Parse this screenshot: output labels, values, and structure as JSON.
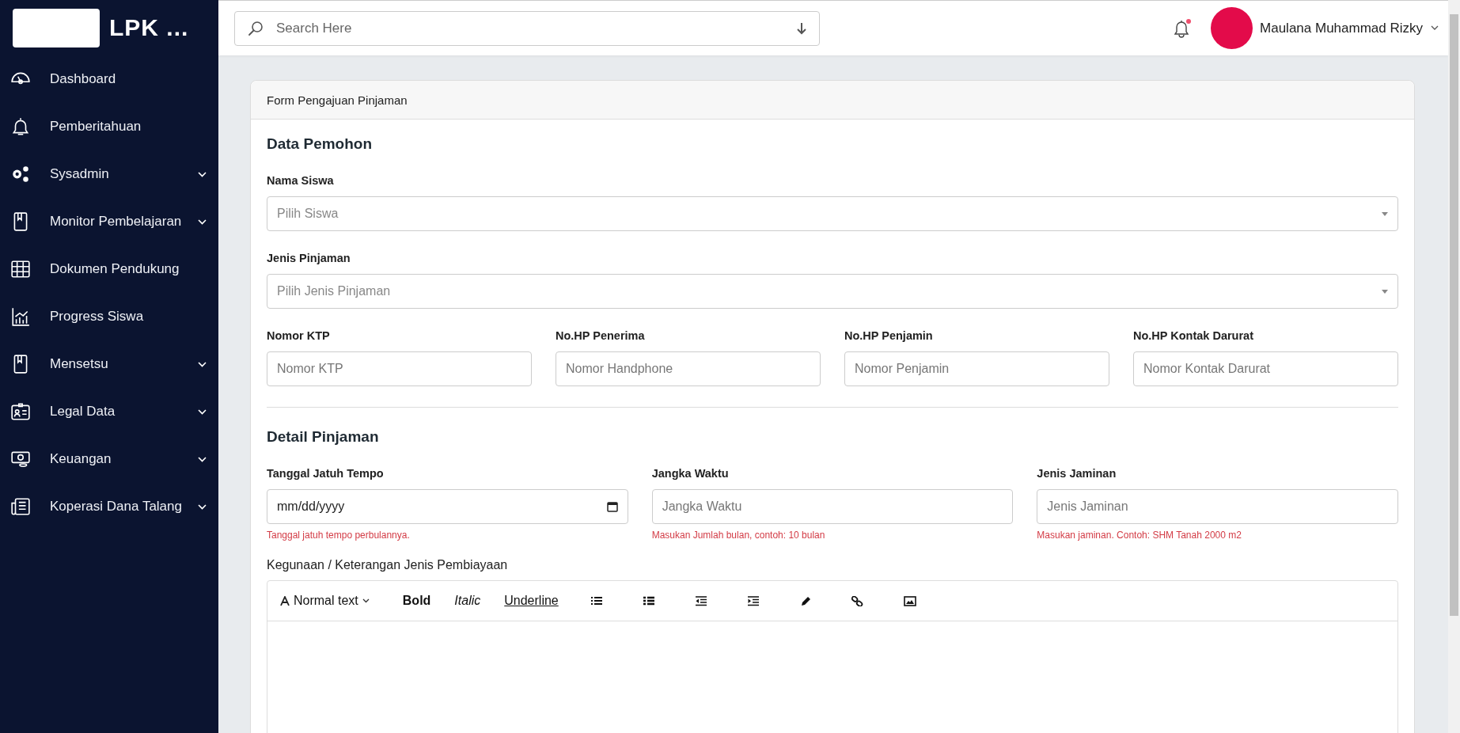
{
  "sidebar": {
    "brand": "LPK ...",
    "items": [
      {
        "label": "Dashboard",
        "expandable": false
      },
      {
        "label": "Pemberitahuan",
        "expandable": false
      },
      {
        "label": "Sysadmin",
        "expandable": true
      },
      {
        "label": "Monitor Pembelajaran",
        "expandable": true
      },
      {
        "label": "Dokumen Pendukung",
        "expandable": false
      },
      {
        "label": "Progress Siswa",
        "expandable": false
      },
      {
        "label": "Mensetsu",
        "expandable": true
      },
      {
        "label": "Legal Data",
        "expandable": true
      },
      {
        "label": "Keuangan",
        "expandable": true
      },
      {
        "label": "Koperasi Dana Talang",
        "expandable": true
      }
    ]
  },
  "topbar": {
    "search": {
      "placeholder": "Search Here"
    },
    "notification": {
      "unread": true
    },
    "user": {
      "name": "Maulana Muhammad Rizky"
    }
  },
  "card": {
    "title": "Form Pengajuan Pinjaman",
    "sections": [
      {
        "heading": "Data Pemohon",
        "rows": [
          [
            {
              "kind": "select",
              "label": "Nama Siswa",
              "placeholder": "Pilih Siswa"
            }
          ],
          [
            {
              "kind": "select",
              "label": "Jenis Pinjaman",
              "placeholder": "Pilih Jenis Pinjaman"
            }
          ],
          [
            {
              "kind": "text",
              "label": "Nomor KTP",
              "placeholder": "Nomor KTP"
            },
            {
              "kind": "text",
              "label": "No.HP Penerima",
              "placeholder": "Nomor Handphone"
            },
            {
              "kind": "text",
              "label": "No.HP Penjamin",
              "placeholder": "Nomor Penjamin"
            },
            {
              "kind": "text",
              "label": "No.HP Kontak Darurat",
              "placeholder": "Nomor Kontak Darurat"
            }
          ]
        ]
      },
      {
        "heading": "Detail Pinjaman",
        "rows": [
          [
            {
              "kind": "date",
              "label": "Tanggal Jatuh Tempo",
              "value": "mm/dd/yyyy",
              "help": "Tanggal jatuh tempo perbulannya."
            },
            {
              "kind": "text",
              "label": "Jangka Waktu",
              "placeholder": "Jangka Waktu",
              "help": "Masukan Jumlah bulan, contoh: 10 bulan"
            },
            {
              "kind": "text",
              "label": "Jenis Jaminan",
              "placeholder": "Jenis Jaminan",
              "help": "Masukan jaminan.  Contoh: SHM Tanah 2000 m2"
            }
          ]
        ]
      }
    ],
    "editor": {
      "label": "Kegunaan / Keterangan Jenis Pembiayaan",
      "toolbar": [
        {
          "kind": "dropdown",
          "label": "Normal text"
        },
        {
          "kind": "bold",
          "label": "Bold"
        },
        {
          "kind": "italic",
          "label": "Italic"
        },
        {
          "kind": "underline",
          "label": "Underline"
        }
      ]
    }
  }
}
